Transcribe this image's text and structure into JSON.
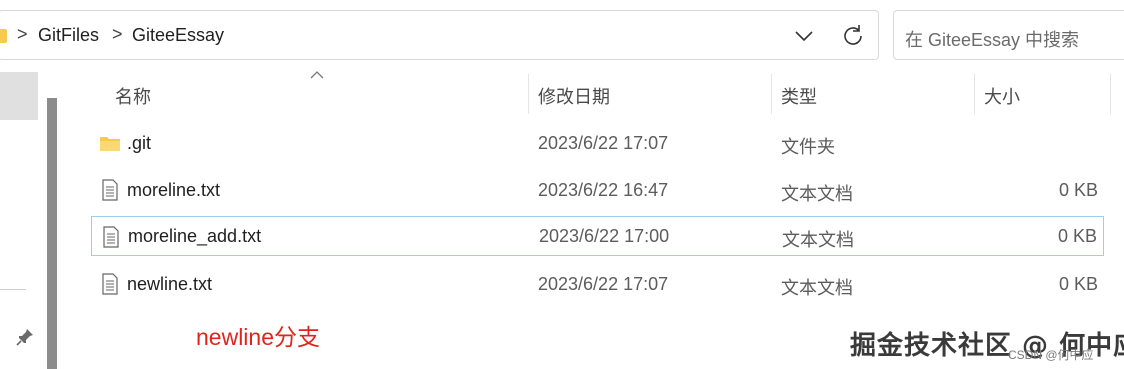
{
  "breadcrumb": {
    "items": [
      "GitFiles",
      "GiteeEssay"
    ],
    "separator": ">"
  },
  "search": {
    "placeholder": "在 GiteeEssay 中搜索"
  },
  "columns": {
    "name": "名称",
    "modified": "修改日期",
    "type": "类型",
    "size": "大小"
  },
  "files": [
    {
      "name": ".git",
      "modified": "2023/6/22 17:07",
      "type": "文件夹",
      "size": "",
      "icon": "folder-icon"
    },
    {
      "name": "moreline.txt",
      "modified": "2023/6/22 16:47",
      "type": "文本文档",
      "size": "0 KB",
      "icon": "text-file-icon"
    },
    {
      "name": "moreline_add.txt",
      "modified": "2023/6/22 17:00",
      "type": "文本文档",
      "size": "0 KB",
      "icon": "text-file-icon"
    },
    {
      "name": "newline.txt",
      "modified": "2023/6/22 17:07",
      "type": "文本文档",
      "size": "0 KB",
      "icon": "text-file-icon"
    }
  ],
  "annotation": "newline分支",
  "watermark": {
    "main": "掘金技术社区 @ 何中应",
    "small": "CSDN @何中应"
  },
  "colors": {
    "annotation": "#e0261c",
    "selection_border": "#99d1ec",
    "folder": "#f7c94c"
  }
}
